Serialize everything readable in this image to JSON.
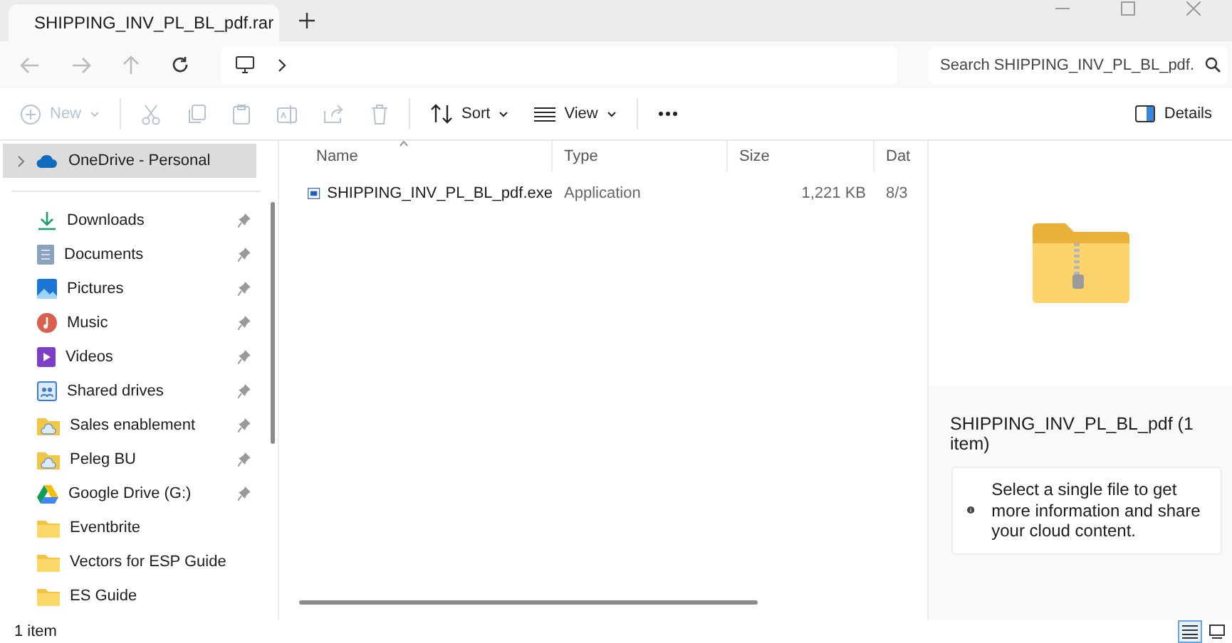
{
  "tabs": [
    {
      "label": "SHIPPING_INV_PL_BL_pdf.rar",
      "selected": true
    }
  ],
  "nav": {
    "search_placeholder": "Search SHIPPING_INV_PL_BL_pdf."
  },
  "toolbar": [
    {
      "kind": "new",
      "label": "New",
      "disabled": true
    },
    {
      "kind": "cut",
      "disabled": true
    },
    {
      "kind": "copy",
      "disabled": true
    },
    {
      "kind": "paste",
      "disabled": true
    },
    {
      "kind": "rename",
      "disabled": true
    },
    {
      "kind": "share",
      "disabled": true
    },
    {
      "kind": "delete",
      "disabled": true
    },
    {
      "kind": "sort",
      "label": "Sort",
      "disabled": false
    },
    {
      "kind": "view",
      "label": "View",
      "disabled": false
    },
    {
      "kind": "more",
      "disabled": false
    }
  ],
  "details_button": {
    "label": "Details"
  },
  "sidebar": {
    "top": [
      {
        "label": "OneDrive - Personal",
        "kind": "cloud",
        "selected": true
      }
    ],
    "items": [
      {
        "label": "Downloads",
        "kind": "download",
        "pinned": true
      },
      {
        "label": "Documents",
        "kind": "document",
        "pinned": true
      },
      {
        "label": "Pictures",
        "kind": "picture",
        "pinned": true
      },
      {
        "label": "Music",
        "kind": "music",
        "pinned": true
      },
      {
        "label": "Videos",
        "kind": "video",
        "pinned": true
      },
      {
        "label": "Shared drives",
        "kind": "shared",
        "pinned": true
      },
      {
        "label": "Sales enablement",
        "kind": "cloudfolder",
        "pinned": true
      },
      {
        "label": "Peleg BU",
        "kind": "cloudfolder",
        "pinned": true
      },
      {
        "label": "Google Drive (G:)",
        "kind": "drive",
        "pinned": true
      },
      {
        "label": "Eventbrite",
        "kind": "folder",
        "pinned": false
      },
      {
        "label": "Vectors for ESP Guide",
        "kind": "folder",
        "pinned": false
      },
      {
        "label": "ES Guide",
        "kind": "folder",
        "pinned": false
      }
    ]
  },
  "table": {
    "columns": [
      {
        "label": "Name",
        "sorted": true
      },
      {
        "label": "Type",
        "sorted": false
      },
      {
        "label": "Size",
        "sorted": false
      },
      {
        "label": "Dat",
        "sorted": false
      }
    ],
    "rows": [
      {
        "name": "SHIPPING_INV_PL_BL_pdf.exe",
        "type": "Application",
        "size": "1,221 KB",
        "date": "8/3"
      }
    ]
  },
  "details": {
    "title": "SHIPPING_INV_PL_BL_pdf (1 item)",
    "message": "Select a single file to get more information and share your cloud content."
  },
  "status_bar": {
    "count": "1 item"
  },
  "view_modes": [
    {
      "kind": "list",
      "selected": true
    },
    {
      "kind": "tiles",
      "selected": false
    }
  ]
}
